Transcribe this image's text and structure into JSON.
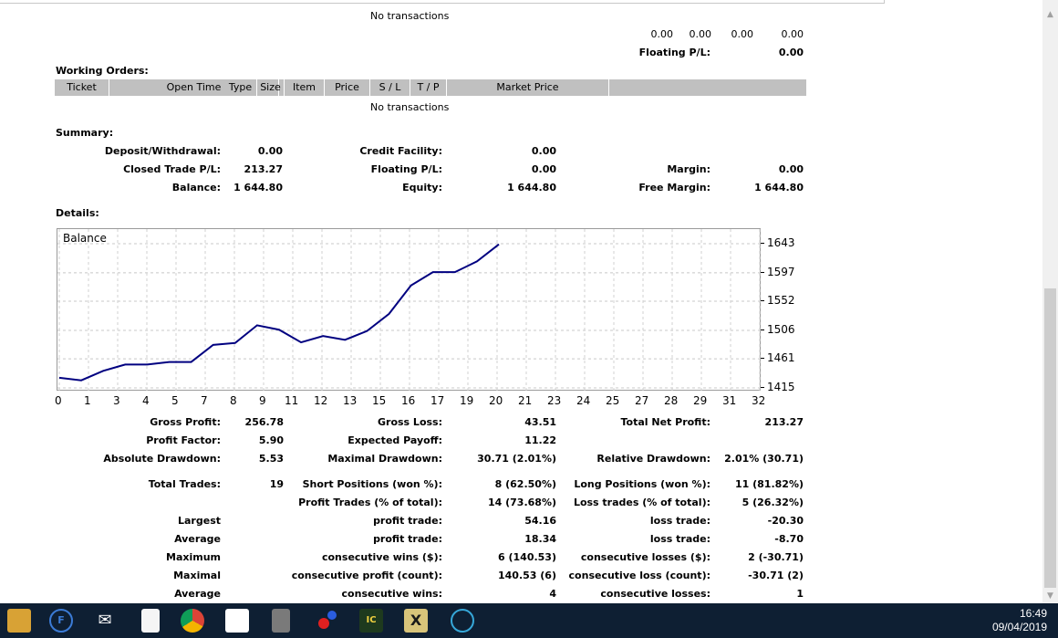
{
  "report": {
    "open_positions_empty": "No transactions",
    "totals_row": [
      "0.00",
      "0.00",
      "0.00",
      "0.00"
    ],
    "floating_pl_label": "Floating P/L:",
    "floating_pl_value": "0.00",
    "working_orders_title": "Working Orders:",
    "working_orders_columns": [
      "Ticket",
      "Open Time",
      "Type",
      "Size",
      "Item",
      "Price",
      "S / L",
      "T / P",
      "Market Price",
      ""
    ],
    "working_orders_empty": "No transactions",
    "summary_title": "Summary:",
    "summary": {
      "deposit_label": "Deposit/Withdrawal:",
      "deposit_value": "0.00",
      "credit_label": "Credit Facility:",
      "credit_value": "0.00",
      "closed_label": "Closed Trade P/L:",
      "closed_value": "213.27",
      "floating_label": "Floating P/L:",
      "floating_value": "0.00",
      "margin_label": "Margin:",
      "margin_value": "0.00",
      "balance_label": "Balance:",
      "balance_value": "1 644.80",
      "equity_label": "Equity:",
      "equity_value": "1 644.80",
      "free_margin_label": "Free Margin:",
      "free_margin_value": "1 644.80"
    },
    "details_title": "Details:",
    "stats": {
      "gross_profit_label": "Gross Profit:",
      "gross_profit": "256.78",
      "gross_loss_label": "Gross Loss:",
      "gross_loss": "43.51",
      "total_net_label": "Total Net Profit:",
      "total_net": "213.27",
      "profit_factor_label": "Profit Factor:",
      "profit_factor": "5.90",
      "expected_payoff_label": "Expected Payoff:",
      "expected_payoff": "11.22",
      "abs_dd_label": "Absolute Drawdown:",
      "abs_dd": "5.53",
      "max_dd_label": "Maximal Drawdown:",
      "max_dd": "30.71 (2.01%)",
      "rel_dd_label": "Relative Drawdown:",
      "rel_dd": "2.01% (30.71)",
      "total_trades_label": "Total Trades:",
      "total_trades": "19",
      "short_label": "Short Positions (won %):",
      "short": "8 (62.50%)",
      "long_label": "Long Positions (won %):",
      "long": "11 (81.82%)",
      "profit_trades_label": "Profit Trades (% of total):",
      "profit_trades": "14 (73.68%)",
      "loss_trades_label": "Loss trades (% of total):",
      "loss_trades": "5 (26.32%)",
      "largest_label": "Largest",
      "largest_profit_label": "profit trade:",
      "largest_profit": "54.16",
      "largest_loss_label": "loss trade:",
      "largest_loss": "-20.30",
      "average_label": "Average",
      "avg_profit_label": "profit trade:",
      "avg_profit": "18.34",
      "avg_loss_label": "loss trade:",
      "avg_loss": "-8.70",
      "maximum_label": "Maximum",
      "max_cons_wins_label": "consecutive wins ($):",
      "max_cons_wins": "6 (140.53)",
      "max_cons_losses_label": "consecutive losses ($):",
      "max_cons_losses": "2 (-30.71)",
      "maximal_label": "Maximal",
      "maximal_cons_profit_label": "consecutive profit (count):",
      "maximal_cons_profit": "140.53 (6)",
      "maximal_cons_loss_label": "consecutive loss (count):",
      "maximal_cons_loss": "-30.71 (2)",
      "average2_label": "Average",
      "avg_cons_wins_label": "consecutive wins:",
      "avg_cons_wins": "4",
      "avg_cons_losses_label": "consecutive losses:",
      "avg_cons_losses": "1"
    }
  },
  "chart_data": {
    "type": "line",
    "title": "Balance",
    "x_ticks": [
      "0",
      "1",
      "3",
      "4",
      "5",
      "7",
      "8",
      "9",
      "11",
      "12",
      "13",
      "15",
      "16",
      "17",
      "19",
      "20",
      "21",
      "23",
      "24",
      "25",
      "27",
      "28",
      "29",
      "31",
      "32"
    ],
    "y_ticks": [
      "1643",
      "1597",
      "1552",
      "1506",
      "1461",
      "1415"
    ],
    "ylim": [
      1415,
      1643
    ],
    "x": [
      0,
      1,
      2,
      3,
      4,
      5,
      6,
      7,
      8,
      9,
      10,
      11,
      12,
      13,
      14,
      15,
      16,
      17,
      18,
      19
    ],
    "values": [
      1431,
      1427,
      1442,
      1452,
      1452,
      1456,
      1456,
      1483,
      1486,
      1514,
      1507,
      1487,
      1497,
      1491,
      1505,
      1532,
      1577,
      1598,
      1598,
      1615,
      1642
    ],
    "line_color": "#000080",
    "grid": true
  },
  "taskbar": {
    "icons": [
      "file-explorer-icon",
      "foxit-icon",
      "mail-icon",
      "notepad-icon",
      "chrome-icon",
      "store-icon",
      "server-icon",
      "paint-icon",
      "meta-icon",
      "excel-icon",
      "terminal-icon"
    ],
    "time": "16:49",
    "date": "09/04/2019"
  }
}
